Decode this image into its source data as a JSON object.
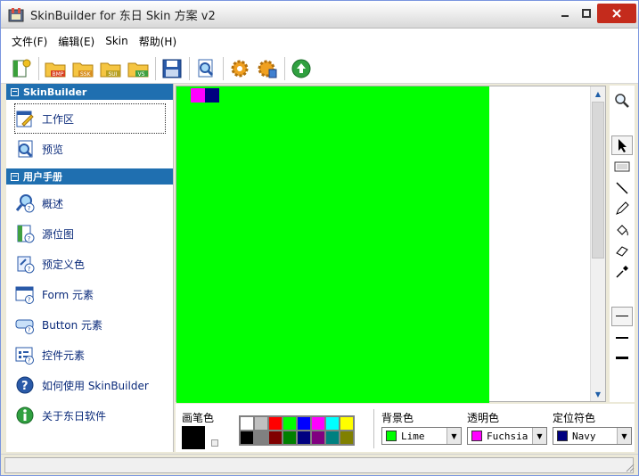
{
  "window": {
    "title": "SkinBuilder for 东日 Skin 方案 v2"
  },
  "menu": [
    "文件(F)",
    "编辑(E)",
    "Skin",
    "帮助(H)"
  ],
  "toolbar": [
    {
      "name": "new-skin",
      "icon": "new-document-icon"
    },
    {
      "name": "open-bmp",
      "icon": "folder-icon",
      "badge": "BMP"
    },
    {
      "name": "open-ssk",
      "icon": "folder-icon",
      "badge": "SSK"
    },
    {
      "name": "open-sui",
      "icon": "folder-icon",
      "badge": "SUI"
    },
    {
      "name": "open-vs",
      "icon": "folder-icon",
      "badge": "VS"
    },
    {
      "name": "save",
      "icon": "floppy-disk-icon"
    },
    {
      "name": "preview",
      "icon": "magnifier-document-icon"
    },
    {
      "name": "settings",
      "icon": "gear-icon"
    },
    {
      "name": "properties",
      "icon": "gear-doc-icon"
    },
    {
      "name": "publish",
      "icon": "green-upload-icon"
    }
  ],
  "sidebar": {
    "section1": {
      "title": "SkinBuilder",
      "items": [
        {
          "label": "工作区",
          "icon": "pencil-notepad-icon",
          "selected": true
        },
        {
          "label": "预览",
          "icon": "preview-icon",
          "selected": false
        }
      ]
    },
    "section2": {
      "title": "用户手册",
      "items": [
        {
          "label": "概述",
          "icon": "magnifier-help-icon"
        },
        {
          "label": "源位图",
          "icon": "bitmap-help-icon"
        },
        {
          "label": "预定义色",
          "icon": "color-help-icon"
        },
        {
          "label": "Form 元素",
          "icon": "form-help-icon"
        },
        {
          "label": "Button 元素",
          "icon": "button-help-icon"
        },
        {
          "label": "控件元素",
          "icon": "control-help-icon"
        },
        {
          "label": "如何使用 SkinBuilder",
          "icon": "question-icon"
        },
        {
          "label": "关于东日软件",
          "icon": "info-icon"
        }
      ]
    }
  },
  "canvas": {
    "background": "#00ff00",
    "pixels": [
      {
        "color": "#ff00ff"
      },
      {
        "color": "#000080"
      }
    ]
  },
  "tools": [
    "zoom-icon",
    "pointer-icon",
    "rectangle-icon",
    "line-icon",
    "pencil-icon",
    "fill-bucket-icon",
    "eraser-icon",
    "eyedropper-icon",
    "thin-line-icon",
    "medium-line-icon",
    "thick-line-icon"
  ],
  "palette": {
    "pen_label": "画笔色",
    "pen_color": "#000000",
    "colors_row1": [
      "#ffffff",
      "#c0c0c0",
      "#ff0000",
      "#00ff00",
      "#0000ff",
      "#ff00ff",
      "#00ffff",
      "#ffff00"
    ],
    "colors_row2": [
      "#000000",
      "#808080",
      "#800000",
      "#008000",
      "#000080",
      "#800080",
      "#008080",
      "#808000"
    ],
    "background": {
      "label": "背景色",
      "value": "Lime",
      "color": "#00ff00"
    },
    "transparent": {
      "label": "透明色",
      "value": "Fuchsia",
      "color": "#ff00ff"
    },
    "locator": {
      "label": "定位符色",
      "value": "Navy",
      "color": "#000080"
    }
  }
}
